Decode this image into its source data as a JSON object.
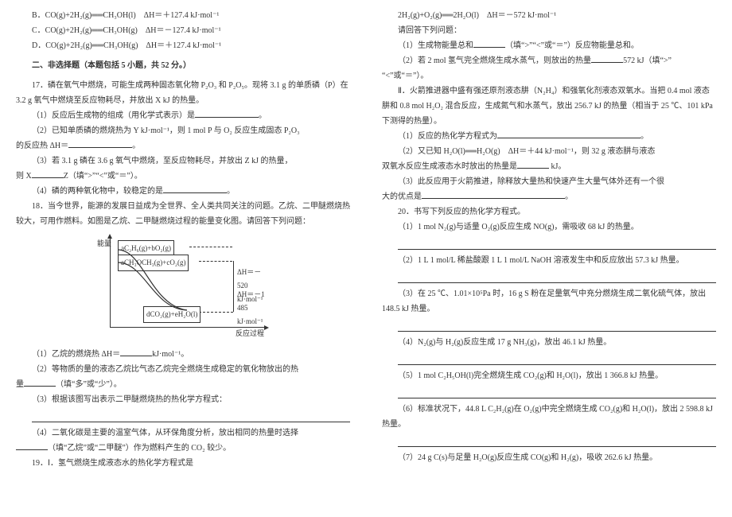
{
  "left": {
    "optB": "B．CO(g)+2H₂(g)══CH₃OH(l)　ΔH＝＋127.4 kJ·mol⁻¹",
    "optC": "C．CO(g)+2H₂(g)══CH₃OH(g)　ΔH＝－127.4 kJ·mol⁻¹",
    "optD": "D．CO(g)+2H₂(g)══CH₃OH(g)　ΔH＝＋127.4 kJ·mol⁻¹",
    "section": "二、非选择题（本题包括 5 小题，共 52 分。）",
    "q17a": "17．磷在氧气中燃烧，可能生成两种固态氧化物 P₂O₃ 和 P₂O₅。现将 3.1 g 的单质磷（P）在 3.2 g 氧气中燃烧至反应物耗尽，并放出 X kJ 的热量。",
    "q17_1": "（1）反应后生成物的组成（用化学式表示）是",
    "q17_2a": "（2）已知单质磷的燃烧热为 Y kJ·mol⁻¹，则 1 mol P 与 O₂ 反应生成固态 P₂O₃",
    "q17_2b": "的反应热 ΔH＝",
    "q17_3a": "（3）若 3.1 g 磷在 3.6 g 氧气中燃烧，至反应物耗尽，并放出 Z kJ 的热量，",
    "q17_3b_pre": "则 X",
    "q17_3b_mid": "Z（填“>”“<”或“＝”）。",
    "q17_4": "（4）磷的两种氧化物中，较稳定的是",
    "q18a": "18．当今世界，能源的发展日益成为全世界、全人类共同关注的问题。乙烷、二甲醚燃烧热较大，可用作燃料。如图是乙烷、二甲醚燃烧过程的能量变化图。请回答下列问题：",
    "dia": {
      "ylabel": "能量",
      "xlabel": "反应过程",
      "top1": "aC₂H₆(g)+bO₂(g)",
      "top2": "aCH₃OCH₃(g)+cO₂(g)",
      "dh1": "ΔH＝－520 kJ·mol⁻¹",
      "dh2": "ΔH＝－1 485 kJ·mol⁻¹",
      "bottom": "dCO₂(g)+eH₂O(l)"
    },
    "q18_1_pre": "（1）乙烷的燃烧热 ΔH＝",
    "q18_1_suf": "kJ·mol⁻¹。",
    "q18_2a": "（2）等物质的量的液态乙烷比气态乙烷完全燃烧生成稳定的氧化物放出的热",
    "q18_2b_pre": "量",
    "q18_2b_suf": "（填“多”或“少”）。",
    "q18_3": "（3）根据该图写出表示二甲醚燃烧热的热化学方程式：",
    "q18_4a": "（4）二氧化碳是主要的温室气体，从环保角度分析，放出相同的热量时选择",
    "q18_4b_suf": "（填“乙烷”或“二甲醚”）作为燃料产生的 CO₂ 较少。",
    "q19": "19．Ⅰ．氢气燃烧生成液态水的热化学方程式是"
  },
  "right": {
    "eq": "2H₂(g)+O₂(g)══2H₂O(l)　ΔH＝－572 kJ·mol⁻¹",
    "r0": "请回答下列问题：",
    "r1_pre": "（1）生成物能量总和",
    "r1_suf": "（填“>”“<”或“＝”）反应物能量总和。",
    "r2_pre": "（2）若 2 mol 氢气完全燃烧生成水蒸气，则放出的热量",
    "r2_mid": "572 kJ（填“>”",
    "r2_suf": "“<”或“＝”）。",
    "p2a": "Ⅱ．火箭推进器中盛有强还原剂液态肼（N₂H₄）和强氧化剂液态双氧水。当把 0.4 mol 液态肼和 0.8 mol H₂O₂ 混合反应，生成氮气和水蒸气，放出 256.7 kJ 的热量（相当于 25 ℃、101 kPa 下测得的热量）。",
    "p2_1": "（1）反应的热化学方程式为",
    "p2_2a": "（2）又已知 H₂O(l)══H₂O(g)　ΔH＝＋44 kJ·mol⁻¹，则 32 g 液态肼与液态",
    "p2_2b_pre": "双氧水反应生成液态水时放出的热量是",
    "p2_2b_suf": " kJ。",
    "p2_3a": "（3）此反应用于火箭推进，除释放大量热和快速产生大量气体外还有一个很",
    "p2_3b": "大的优点是",
    "q20": "20．书写下列反应的热化学方程式。",
    "q20_1": "（1）1 mol N₂(g)与适量 O₂(g)反应生成 NO(g)，需吸收 68 kJ 的热量。",
    "q20_2": "（2）1 L 1 mol/L 稀盐酸跟 1 L 1 mol/L NaOH 溶液发生中和反应放出 57.3 kJ 热量。",
    "q20_3": "（3）在 25 ℃、1.01×10⁵Pa 时，16 g S 粉在足量氧气中充分燃烧生成二氧化硫气体，放出 148.5 kJ 热量。",
    "q20_4": "（4）N₂(g)与 H₂(g)反应生成 17 g NH₃(g)，放出 46.1 kJ 热量。",
    "q20_5": "（5）1 mol C₂H₅OH(l)完全燃烧生成 CO₂(g)和 H₂O(l)，放出 1 366.8 kJ 热量。",
    "q20_6": "（6）标准状况下，44.8 L C₂H₂(g)在 O₂(g)中完全燃烧生成 CO₂(g)和 H₂O(l)，放出 2 598.8 kJ 热量。",
    "q20_7": "（7）24 g C(s)与足量 H₂O(g)反应生成 CO(g)和 H₂(g)，吸收 262.6 kJ 热量。"
  }
}
